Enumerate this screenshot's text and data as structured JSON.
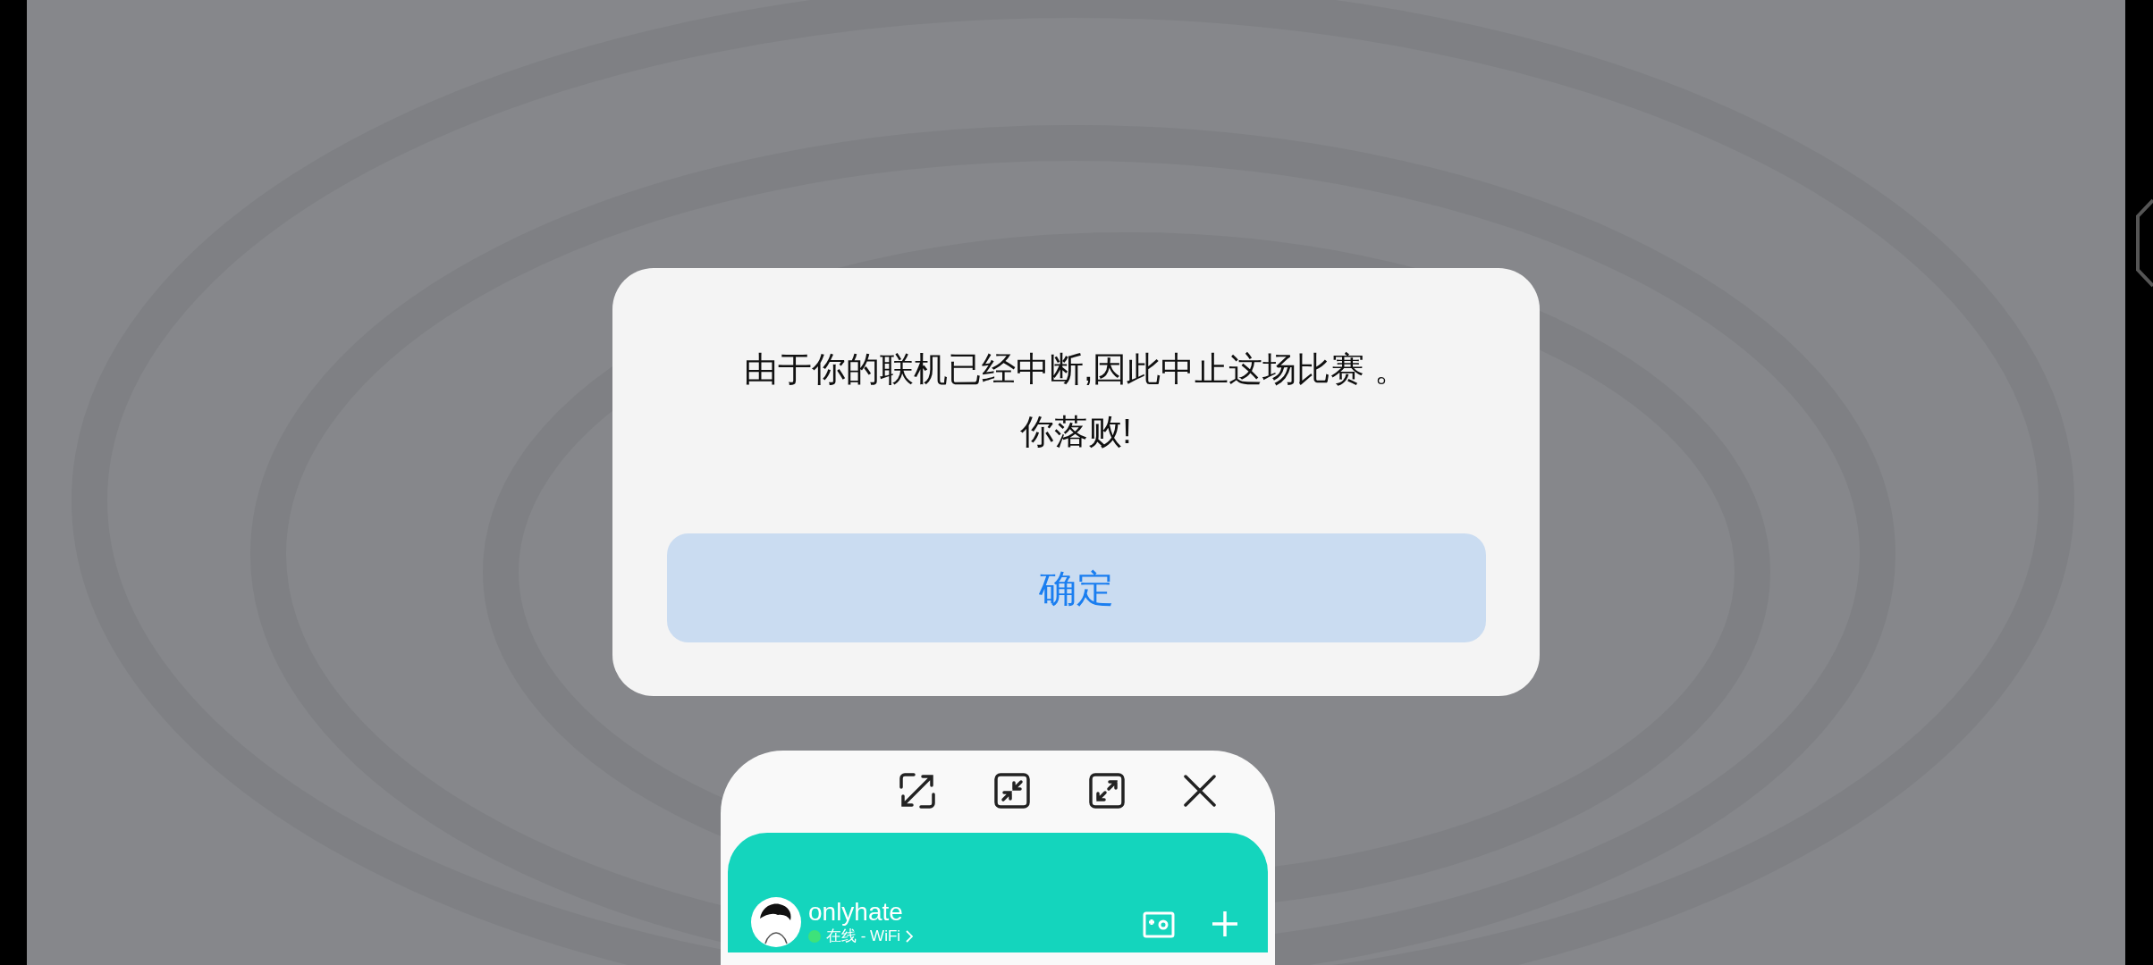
{
  "dialog": {
    "message_lines": [
      "由于你的联机已经中断,因此中止这场比赛 。",
      "你落败!"
    ],
    "button": "确定"
  },
  "floating_window": {
    "user": {
      "name": "onlyhate",
      "status": "在线 - WiFi"
    }
  }
}
